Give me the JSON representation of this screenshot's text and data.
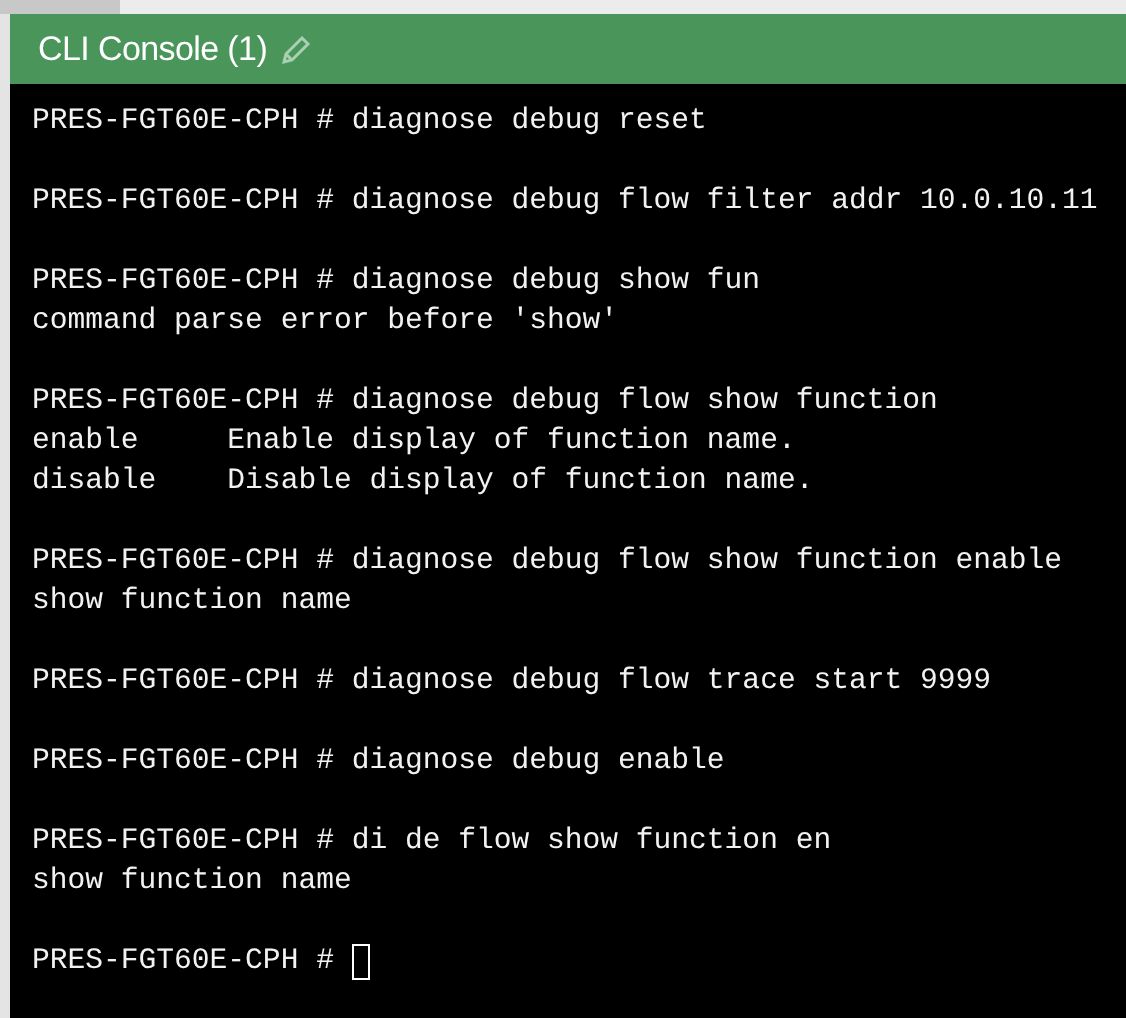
{
  "window": {
    "title": "CLI Console (1)"
  },
  "console": {
    "blocks": [
      [
        {
          "text": "PRES-FGT60E-CPH # diagnose debug reset"
        }
      ],
      [
        {
          "text": "PRES-FGT60E-CPH # diagnose debug flow filter addr 10.0.10.11"
        }
      ],
      [
        {
          "text": "PRES-FGT60E-CPH # diagnose debug show fun"
        },
        {
          "text": "command parse error before 'show'"
        }
      ],
      [
        {
          "text": "PRES-FGT60E-CPH # diagnose debug flow show function"
        },
        {
          "text": "enable     Enable display of function name."
        },
        {
          "text": "disable    Disable display of function name."
        }
      ],
      [
        {
          "text": "PRES-FGT60E-CPH # diagnose debug flow show function enable"
        },
        {
          "text": "show function name"
        }
      ],
      [
        {
          "text": "PRES-FGT60E-CPH # diagnose debug flow trace start 9999"
        }
      ],
      [
        {
          "text": "PRES-FGT60E-CPH # diagnose debug enable"
        }
      ],
      [
        {
          "text": "PRES-FGT60E-CPH # di de flow show function en"
        },
        {
          "text": "show function name"
        }
      ],
      [
        {
          "text": "PRES-FGT60E-CPH # ",
          "cursor": true
        }
      ]
    ]
  }
}
